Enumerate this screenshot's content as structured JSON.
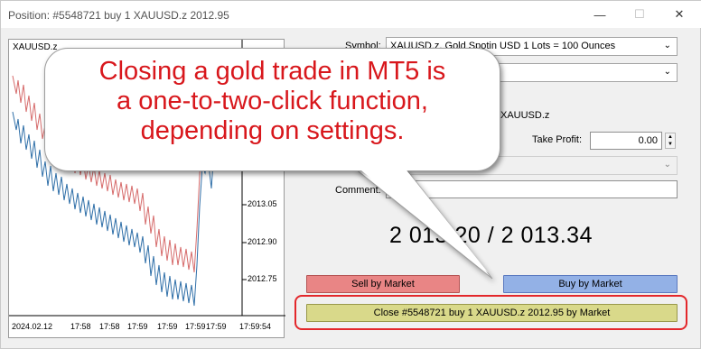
{
  "window": {
    "title": "Position: #5548721 buy 1 XAUUSD.z 2012.95",
    "minimize_glyph": "—",
    "maximize_glyph": "☐",
    "close_glyph": "✕"
  },
  "chart": {
    "symbol": "XAUUSD.z",
    "price_labels": [
      "2013.05",
      "2012.90",
      "2012.75"
    ],
    "time_labels": [
      "2024.02.12",
      "17:58",
      "17:58",
      "17:59",
      "17:59",
      "17:59",
      "17:59",
      "17:59:54"
    ],
    "colors": {
      "ask_line": "#d66b6b",
      "bid_line": "#2f6fa8"
    }
  },
  "form": {
    "symbol_label": "Symbol:",
    "symbol_value": "XAUUSD.z, Gold Spotin USD 1 Lots = 100 Ounces",
    "partial_symbol": "XAUUSD.z",
    "take_profit_label": "Take Profit:",
    "take_profit_value": "0.00",
    "comment_label": "Comment:",
    "comment_value": ""
  },
  "quote": {
    "text": "2 013.20 / 2 013.34"
  },
  "buttons": {
    "sell": "Sell by Market",
    "buy": "Buy by Market",
    "close": "Close #5548721 buy 1 XAUUSD.z 2012.95 by Market"
  },
  "callout": {
    "lines": [
      "Closing a gold trade in MT5 is",
      "a one-to-two-click function,",
      "depending on settings."
    ],
    "text_color": "#d8171c",
    "highlight_color": "#e3272b"
  }
}
